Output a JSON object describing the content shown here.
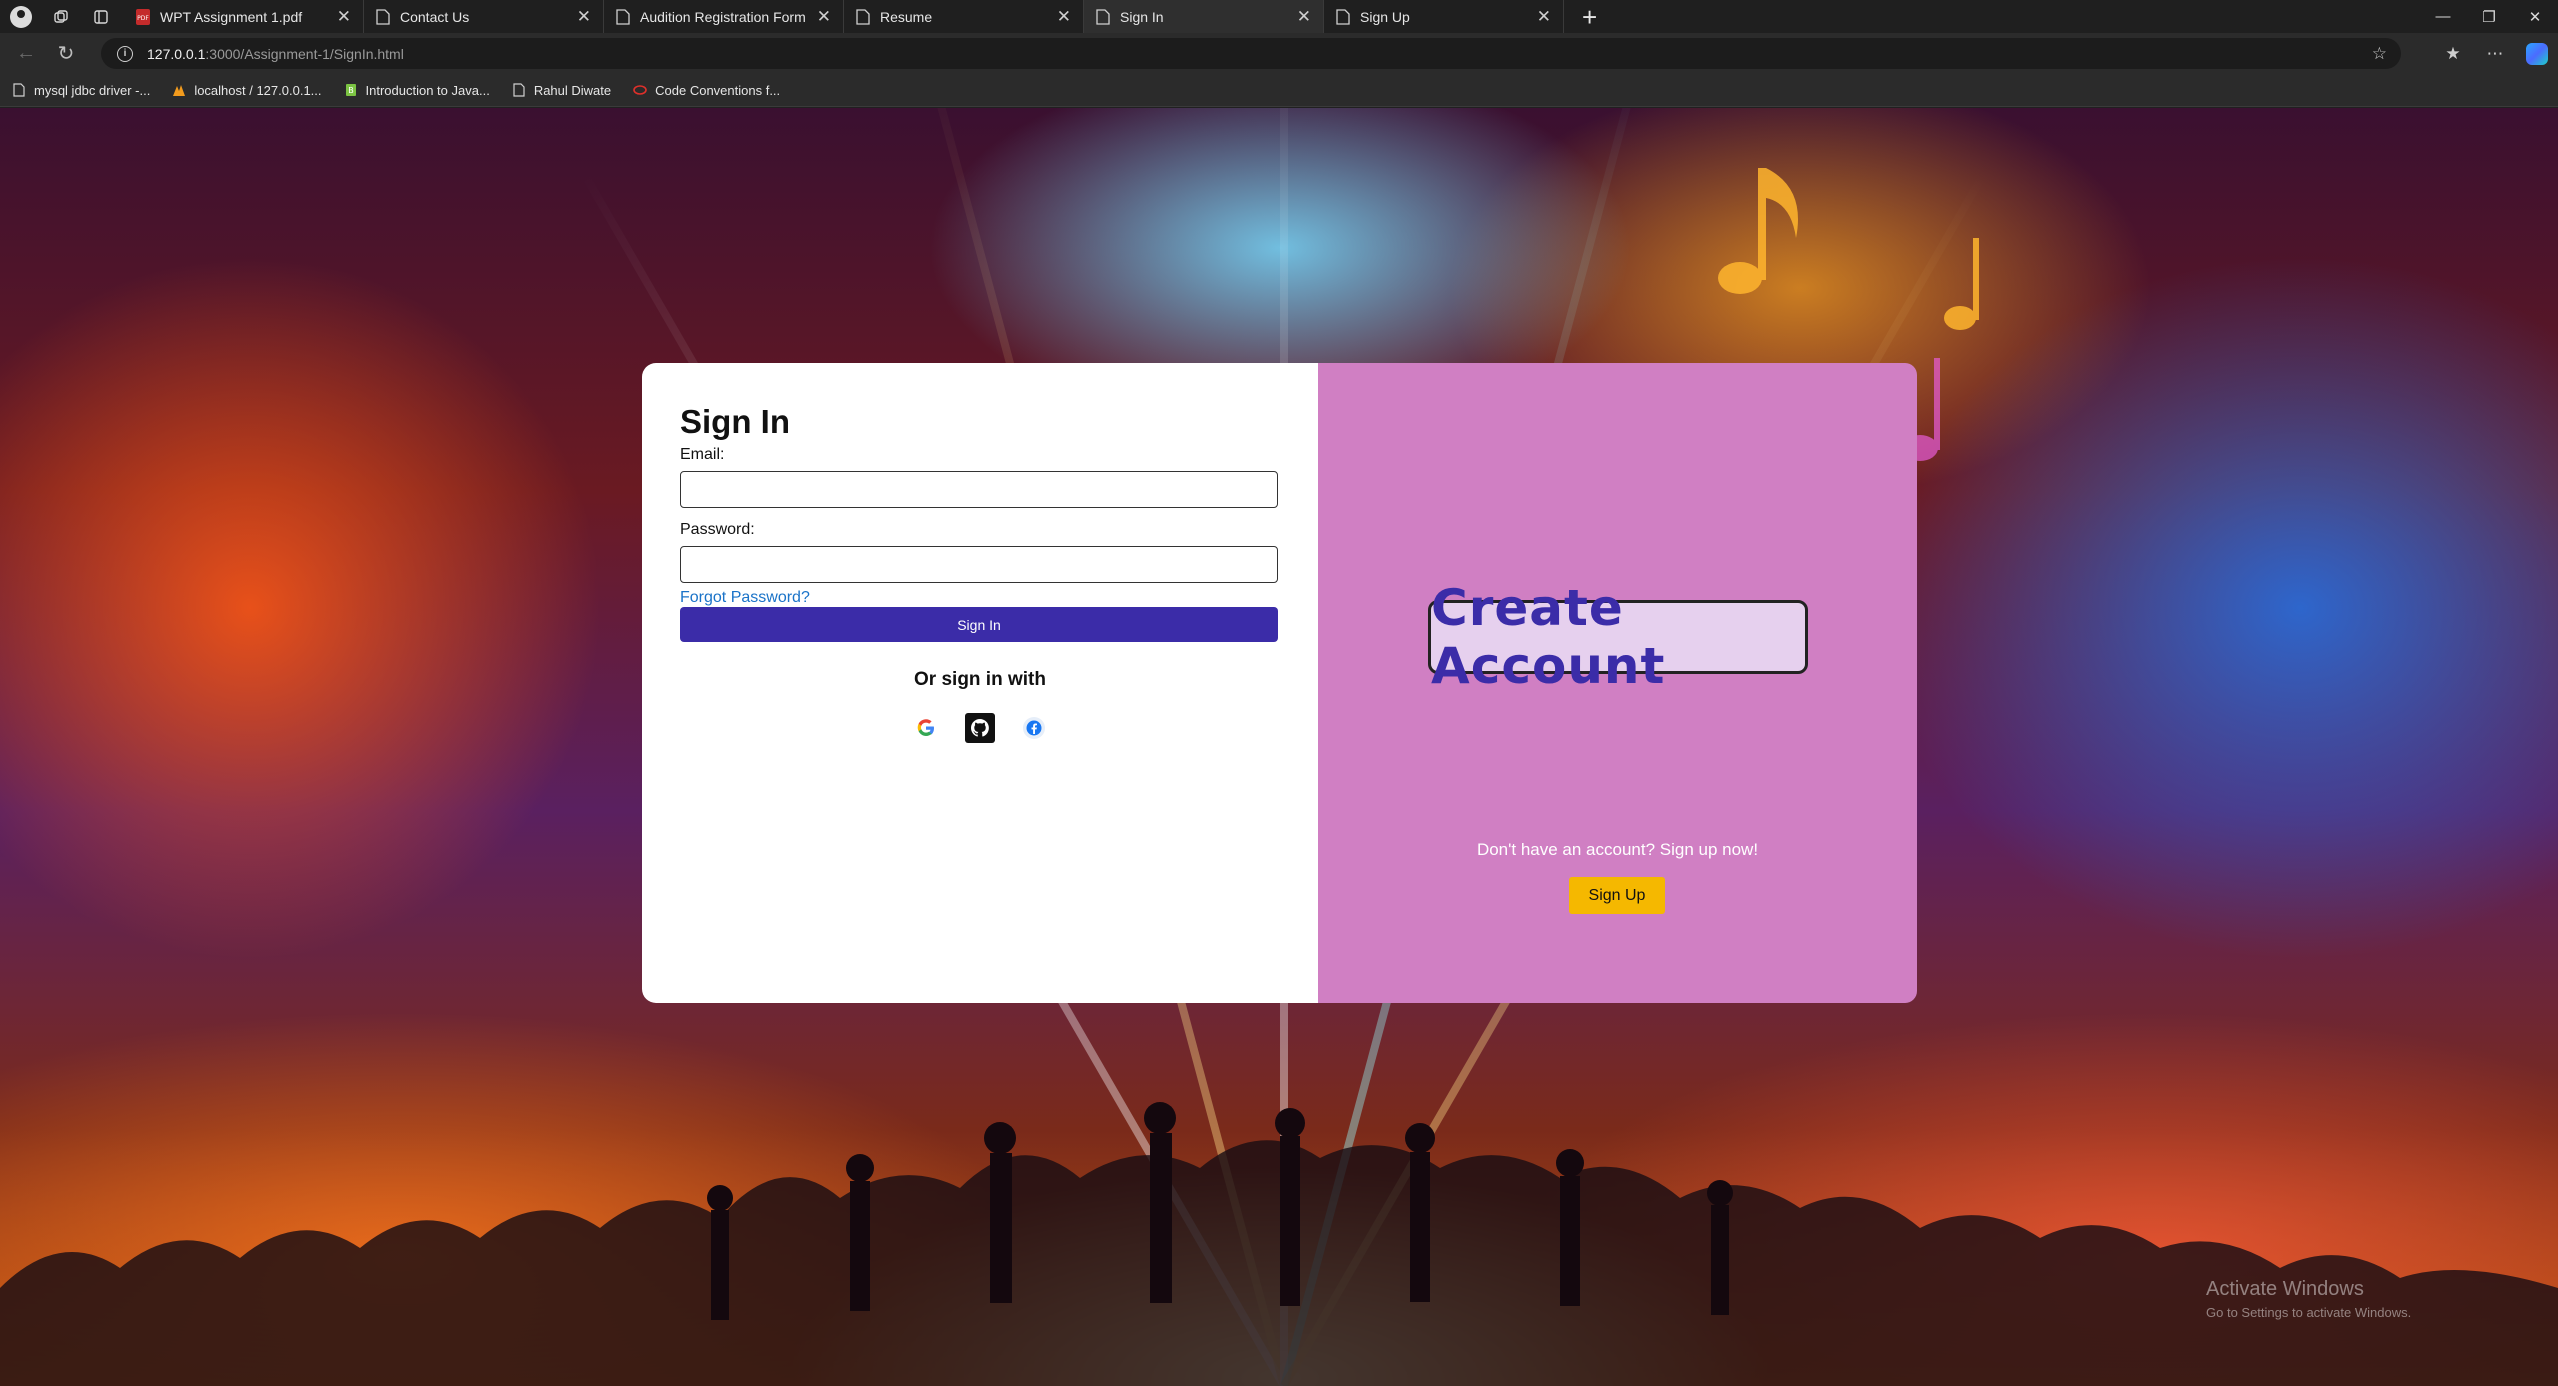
{
  "browser": {
    "tabs": [
      {
        "title": "WPT Assignment 1.pdf",
        "icon": "pdf-icon",
        "active": false
      },
      {
        "title": "Contact Us",
        "icon": "page-icon",
        "active": false
      },
      {
        "title": "Audition Registration Form",
        "icon": "page-icon",
        "active": false
      },
      {
        "title": "Resume",
        "icon": "page-icon",
        "active": false
      },
      {
        "title": "Sign In",
        "icon": "page-icon",
        "active": true
      },
      {
        "title": "Sign Up",
        "icon": "page-icon",
        "active": false
      }
    ],
    "new_tab": "+",
    "close_glyph": "✕",
    "url_host": "127.0.0.1",
    "url_path": ":3000/Assignment-1/SignIn.html",
    "bookmarks": [
      {
        "label": "mysql jdbc driver -...",
        "icon": "page-icon"
      },
      {
        "label": "localhost / 127.0.0.1...",
        "icon": "phpmyadmin-icon"
      },
      {
        "label": "Introduction to Java...",
        "icon": "bookmark-green-icon"
      },
      {
        "label": "Rahul Diwate",
        "icon": "page-icon"
      },
      {
        "label": "Code Conventions f...",
        "icon": "oracle-icon"
      }
    ]
  },
  "signin": {
    "title": "Sign In",
    "email_label": "Email:",
    "email_value": "",
    "password_label": "Password:",
    "password_value": "",
    "forgot_link": "Forgot Password?",
    "submit_label": "Sign In",
    "or_text": "Or sign in with",
    "social": [
      {
        "name": "google-icon"
      },
      {
        "name": "github-icon"
      },
      {
        "name": "facebook-icon"
      }
    ]
  },
  "signup_panel": {
    "title": "Create Account",
    "subtitle": "Don't have an account? Sign up now!",
    "button_label": "Sign Up",
    "background": "#d07fc3",
    "accent": "#3b2ca8",
    "button_color": "#f5b800"
  },
  "os_watermark": {
    "line1": "Activate Windows",
    "line2": "Go to Settings to activate Windows."
  }
}
